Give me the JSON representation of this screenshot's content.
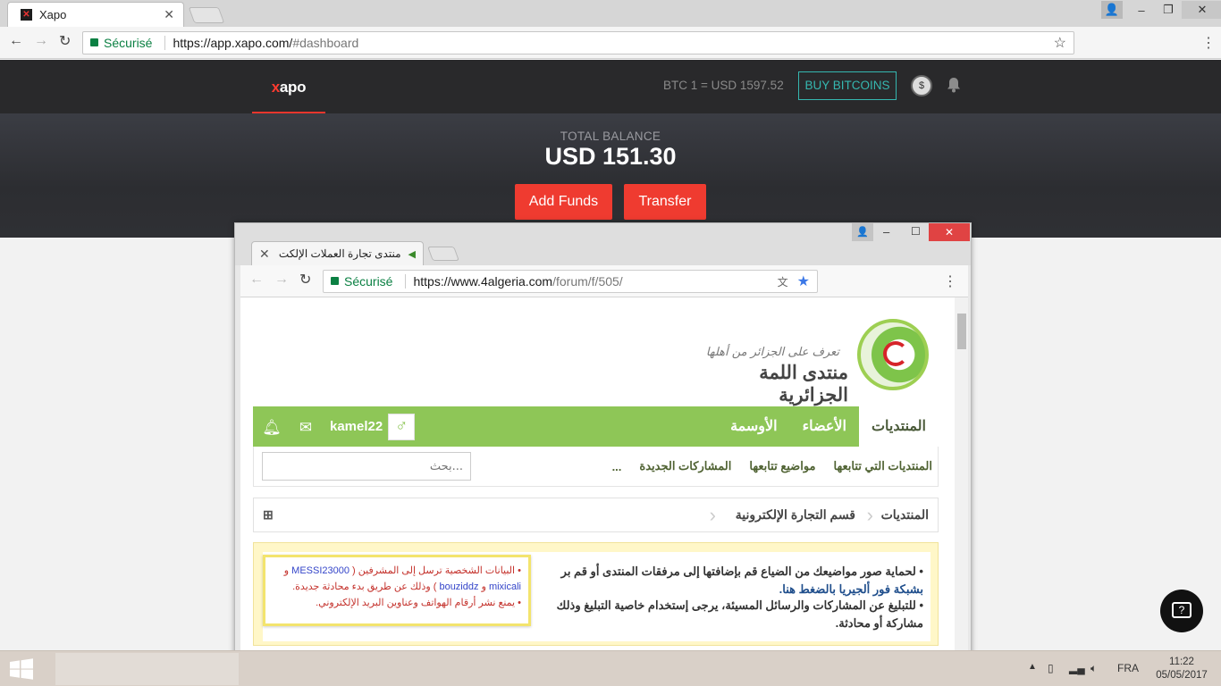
{
  "browser": {
    "tab_title": "Xapo",
    "secure_label": "Sécurisé",
    "url_host": "https://app.xapo.com/",
    "url_path": "#dashboard"
  },
  "xapo": {
    "logo": "xapo",
    "rate": "BTC 1 = USD 1597.52",
    "buy_label": "BUY BITCOINS",
    "total_label": "TOTAL BALANCE",
    "total_value": "USD 151.30",
    "add_funds": "Add Funds",
    "transfer": "Transfer",
    "accent": "#ef3b30",
    "teal": "#35b7b0"
  },
  "inner_browser": {
    "tab_title": "منتدى تجارة العملات الإلكت",
    "secure_label": "Sécurisé",
    "url_host": "https://www.4algeria.com",
    "url_path": "/forum/f/505/"
  },
  "forum": {
    "tagline": "تعرف على الجزائر من أهلها",
    "name": "منتدى اللمة الجزائرية",
    "nav": [
      "المنتديات",
      "الأعضاء",
      "الأوسمة"
    ],
    "username": "kamel22",
    "subnav": [
      "المنتديات التي تتابعها",
      "مواضيع تتابعها",
      "المشاركات الجديدة",
      "..."
    ],
    "search_placeholder": "بحث...",
    "breadcrumb": [
      "المنتديات",
      "قسم التجارة الإلكترونية"
    ],
    "notice_line1": "• لحماية صور مواضيعك من الضياع قم بإضافتها إلى مرفقات المنتدى أو قم بر",
    "notice_line2": "بشبكة فور ألجيريا بالضغط هنا.",
    "notice_line3": "• للتبليغ عن المشاركات والرسائل المسيئة، يرجى إستخدام خاصية التبليغ وذلك",
    "notice_line4": "مشاركة أو محادثة.",
    "popup_l1a": "• البيانات الشخصية ترسل إلى المشرفين (",
    "popup_l1b": "MESSI23000",
    "popup_l1c": "و",
    "popup_l2a": "mixicali",
    "popup_l2b": "و",
    "popup_l2c": "bouziddz",
    "popup_l2d": ") وذلك عن طريق بدء محادثة جديدة.",
    "popup_l3": "• يمنع نشر أرقام الهواتف وعناوين البريد الإلكتروني.",
    "green": "#8ec657"
  },
  "taskbar": {
    "lang": "FRA",
    "time": "11:22",
    "date": "05/05/2017"
  }
}
